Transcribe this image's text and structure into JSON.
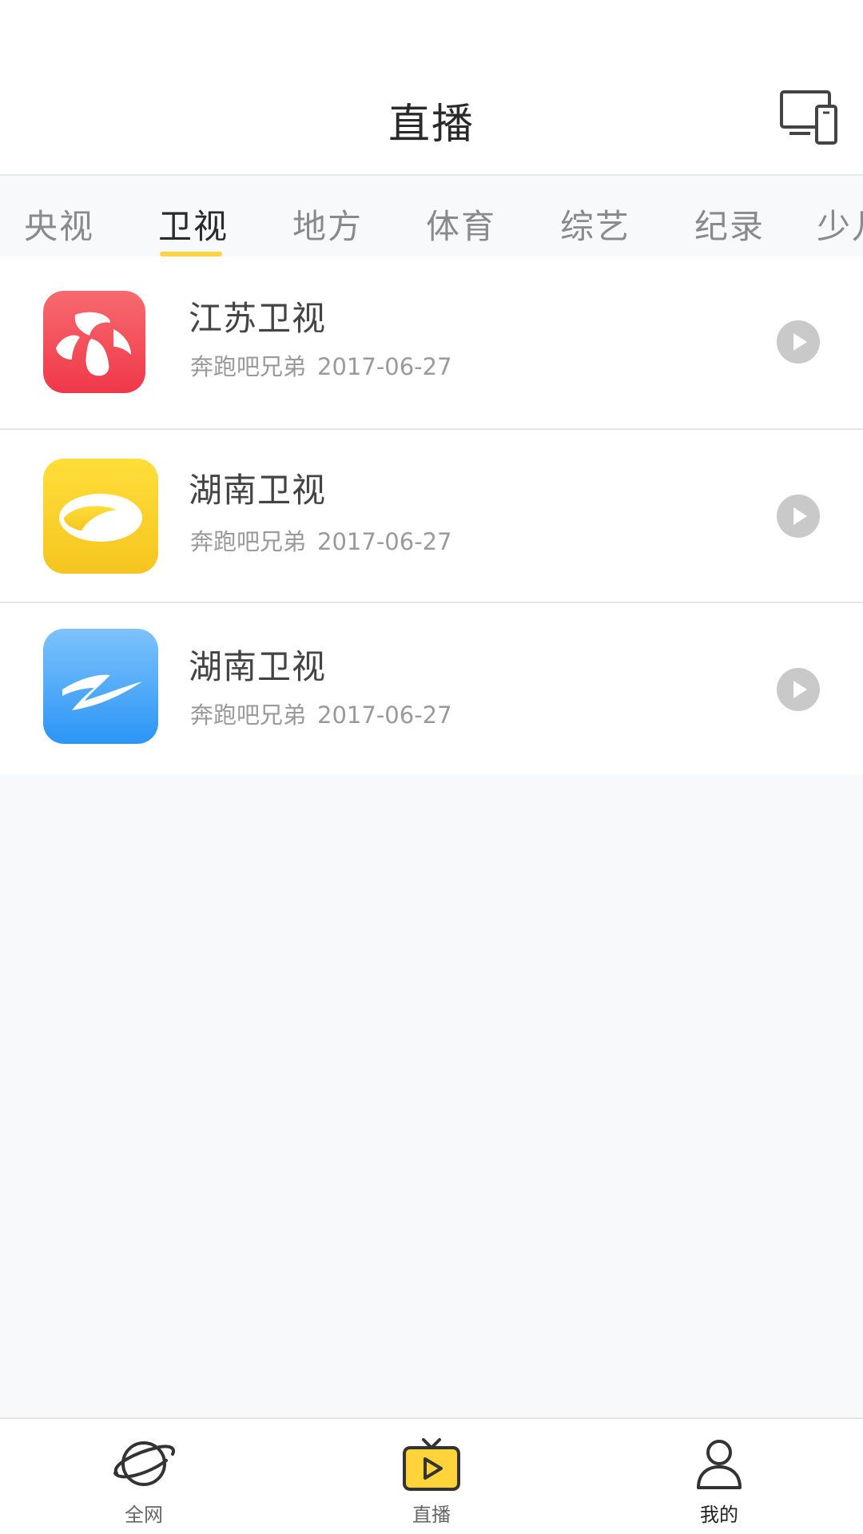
{
  "header": {
    "title": "直播",
    "cast_icon": "cast-devices-icon"
  },
  "tabs": [
    {
      "label": "央视"
    },
    {
      "label": "卫视",
      "active": true
    },
    {
      "label": "地方"
    },
    {
      "label": "体育"
    },
    {
      "label": "综艺"
    },
    {
      "label": "纪录"
    },
    {
      "label": "少儿"
    }
  ],
  "channels": [
    {
      "name": "江苏卫视",
      "program": "奔跑吧兄弟",
      "date": "2017-06-27",
      "logo_color": "#f04a57"
    },
    {
      "name": "湖南卫视",
      "program": "奔跑吧兄弟",
      "date": "2017-06-27",
      "logo_color": "#f8cf22"
    },
    {
      "name": "湖南卫视",
      "program": "奔跑吧兄弟",
      "date": "2017-06-27",
      "logo_color": "#3a9cf5"
    }
  ],
  "tabbar": {
    "items": [
      {
        "label": "全网",
        "icon": "planet-icon"
      },
      {
        "label": "直播",
        "icon": "tv-play-icon",
        "active": true
      },
      {
        "label": "我的",
        "icon": "user-icon"
      }
    ]
  },
  "colors": {
    "accent": "#ffd43b",
    "background": "#f8f9fb"
  }
}
